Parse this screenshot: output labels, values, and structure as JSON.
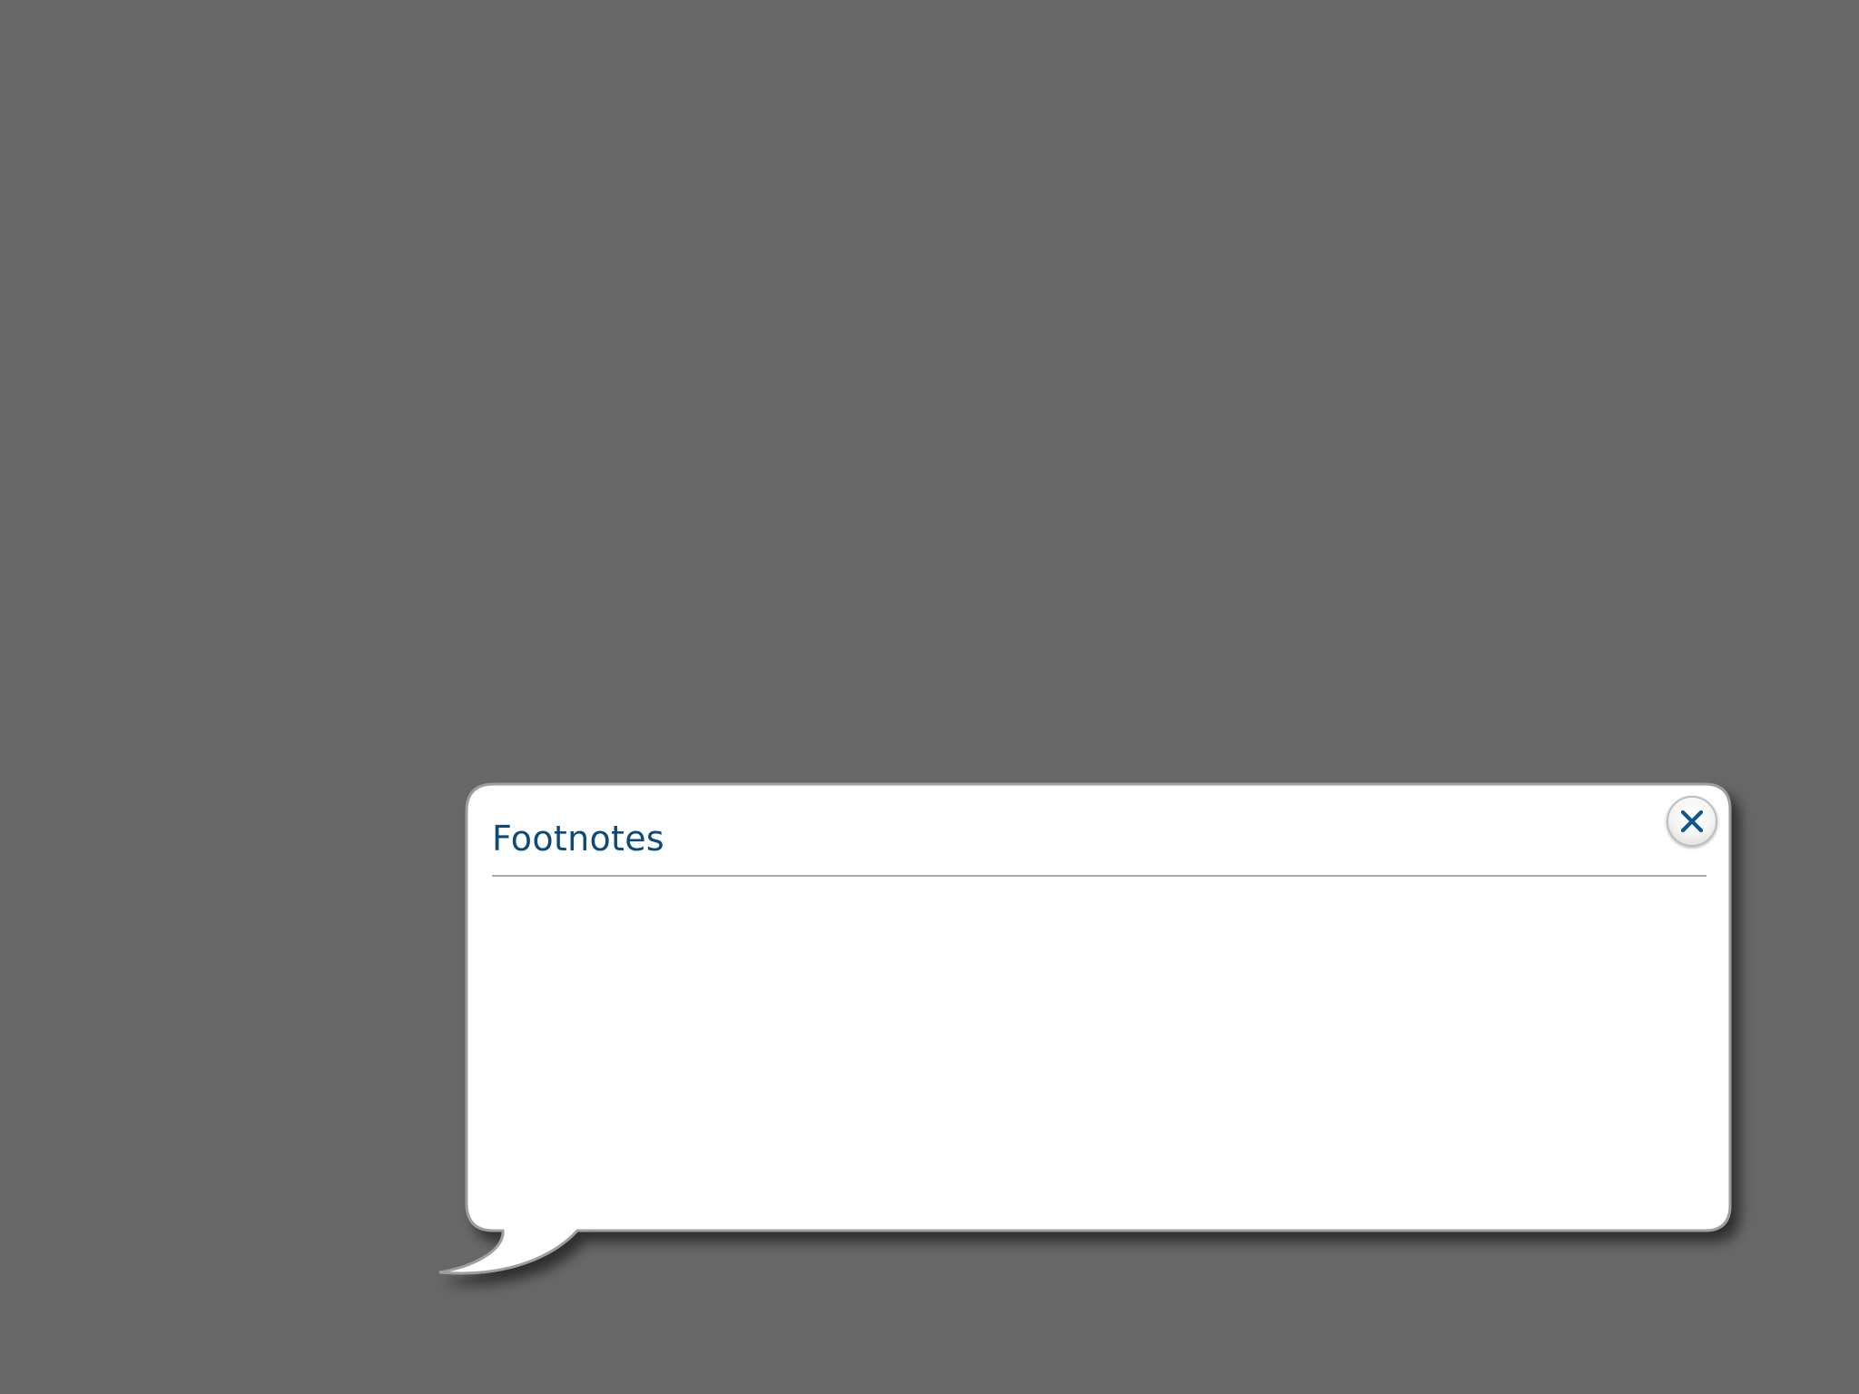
{
  "popup": {
    "title": "Footnotes",
    "close_label": "",
    "close_icon": "close-x-icon",
    "accent_color": "#0d4a7a",
    "footnotes": [
      {
        "marker": "",
        "text": ""
      },
      {
        "marker": "",
        "text": ""
      }
    ]
  },
  "colors": {
    "backdrop": "#676767",
    "panel": "#ffffff",
    "close_x": "#0d5a8a"
  }
}
